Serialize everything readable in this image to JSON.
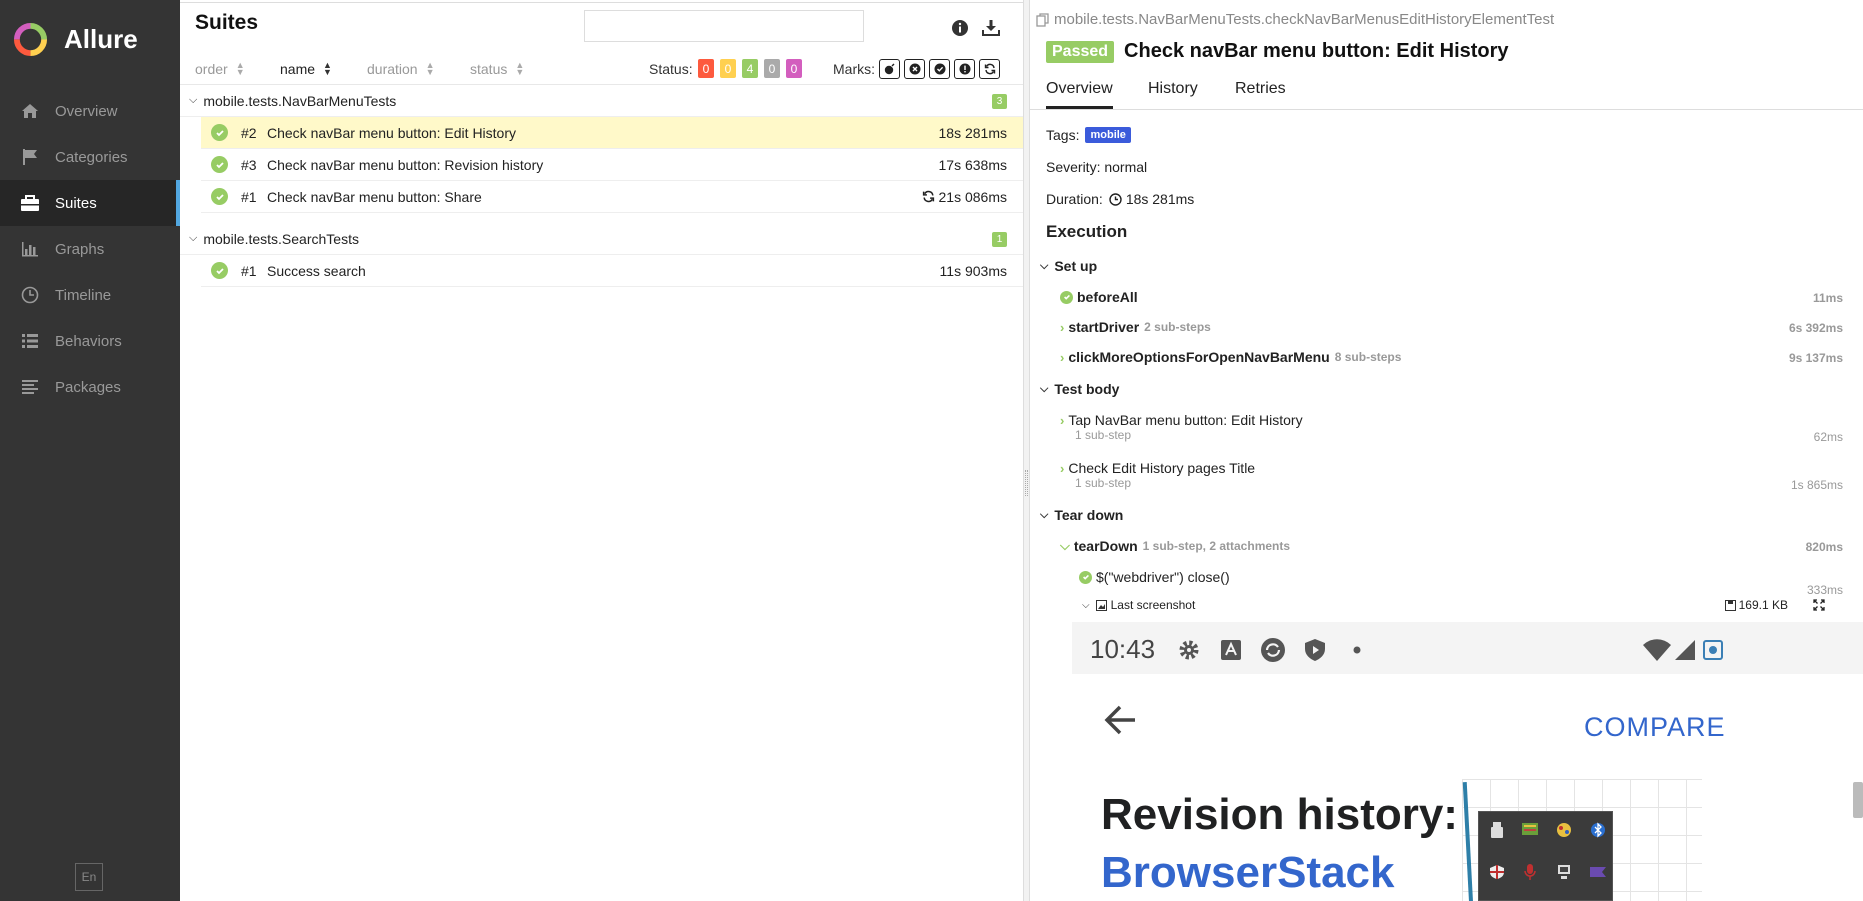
{
  "sidebar": {
    "brand": "Allure",
    "items": [
      {
        "label": "Overview",
        "icon": "home-icon"
      },
      {
        "label": "Categories",
        "icon": "flag-icon"
      },
      {
        "label": "Suites",
        "icon": "briefcase-icon",
        "active": true
      },
      {
        "label": "Graphs",
        "icon": "bar-chart-icon"
      },
      {
        "label": "Timeline",
        "icon": "clock-icon"
      },
      {
        "label": "Behaviors",
        "icon": "list-icon"
      },
      {
        "label": "Packages",
        "icon": "align-left-icon"
      }
    ],
    "language": "En"
  },
  "suites": {
    "title": "Suites",
    "search_placeholder": "",
    "sort": {
      "order": "order",
      "name": "name",
      "duration": "duration",
      "status": "status"
    },
    "status_label": "Status:",
    "status_counts": [
      {
        "value": "0",
        "color": "#fd5a3e"
      },
      {
        "value": "0",
        "color": "#ffd050"
      },
      {
        "value": "4",
        "color": "#97cc64"
      },
      {
        "value": "0",
        "color": "#aaaaaa"
      },
      {
        "value": "0",
        "color": "#d35ebe"
      }
    ],
    "marks_label": "Marks:",
    "groups": [
      {
        "name": "mobile.tests.NavBarMenuTests",
        "count": "3",
        "rows": [
          {
            "num": "#2",
            "name": "Check navBar menu button: Edit History",
            "duration": "18s 281ms",
            "selected": true,
            "retry": false
          },
          {
            "num": "#3",
            "name": "Check navBar menu button: Revision history",
            "duration": "17s 638ms",
            "selected": false,
            "retry": false
          },
          {
            "num": "#1",
            "name": "Check navBar menu button: Share",
            "duration": "21s 086ms",
            "selected": false,
            "retry": true
          }
        ]
      },
      {
        "name": "mobile.tests.SearchTests",
        "count": "1",
        "rows": [
          {
            "num": "#1",
            "name": "Success search",
            "duration": "11s 903ms",
            "selected": false,
            "retry": false
          }
        ]
      }
    ]
  },
  "detail": {
    "breadcrumb": "mobile.tests.NavBarMenuTests.checkNavBarMenusEditHistoryElementTest",
    "status": "Passed",
    "title": "Check navBar menu button: Edit History",
    "tabs": [
      "Overview",
      "History",
      "Retries"
    ],
    "tags_label": "Tags:",
    "tag": "mobile",
    "severity": "Severity: normal",
    "duration_label": "Duration:",
    "duration": "18s 281ms",
    "execution": "Execution",
    "setup": {
      "label": "Set up",
      "steps": [
        {
          "name": "beforeAll",
          "sub": "",
          "time": "11ms"
        },
        {
          "name": "startDriver",
          "sub": "2 sub-steps",
          "time": "6s 392ms"
        },
        {
          "name": "clickMoreOptionsForOpenNavBarMenu",
          "sub": "8 sub-steps",
          "time": "9s 137ms"
        }
      ]
    },
    "body": {
      "label": "Test body",
      "steps": [
        {
          "name": "Tap NavBar menu button: Edit History",
          "sub": "1 sub-step",
          "time": "62ms"
        },
        {
          "name": "Check Edit History pages Title",
          "sub": "1 sub-step",
          "time": "1s 865ms"
        }
      ]
    },
    "teardown": {
      "label": "Tear down",
      "step": {
        "name": "tearDown",
        "sub": "1 sub-step, 2 attachments",
        "time": "820ms"
      },
      "child": {
        "name": "$(\"webdriver\") close()",
        "time": "333ms"
      },
      "attachment": {
        "name": "Last screenshot",
        "size": "169.1 KB"
      }
    }
  },
  "screenshot": {
    "time": "10:43",
    "compare": "COMPARE",
    "title": "Revision history:",
    "link": "BrowserStack"
  }
}
